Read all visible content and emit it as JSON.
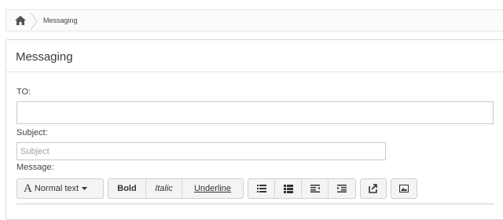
{
  "breadcrumb": {
    "current": "Messaging"
  },
  "panel": {
    "title": "Messaging"
  },
  "form": {
    "to_label": "TO:",
    "to_value": "",
    "subject_label": "Subject:",
    "subject_placeholder": "Subject",
    "subject_value": "",
    "message_label": "Message:"
  },
  "toolbar": {
    "font_size_glyph": "A",
    "font_size_label": "Normal text",
    "bold_label": "Bold",
    "italic_label": "Italic",
    "underline_label": "Underline",
    "icons": [
      "unordered-list-icon",
      "ordered-list-icon",
      "outdent-icon",
      "indent-icon",
      "insert-link-icon",
      "insert-image-icon"
    ]
  }
}
